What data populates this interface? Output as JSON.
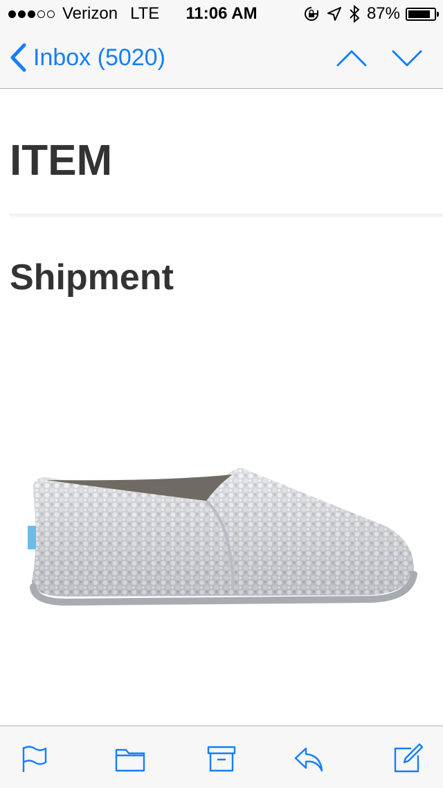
{
  "status_bar": {
    "carrier": "Verizon",
    "network": "LTE",
    "time": "11:06 AM",
    "battery_percent": "87%",
    "battery_level": 0.87,
    "signal_bars_filled": 3,
    "signal_bars_total": 5,
    "icons": [
      "rotation-lock-icon",
      "location-icon",
      "bluetooth-icon",
      "battery-icon"
    ]
  },
  "nav": {
    "back_label": "Inbox (5020)",
    "icons": [
      "chevron-left-icon",
      "chevron-up-icon",
      "chevron-down-icon"
    ]
  },
  "email": {
    "heading": "ITEM",
    "subheading": "Shipment",
    "image": "silver-glitter-slip-on-shoe"
  },
  "toolbar": {
    "icons": [
      "flag-icon",
      "folder-icon",
      "archive-icon",
      "reply-icon",
      "compose-icon"
    ]
  },
  "colors": {
    "accent": "#157efb",
    "heading_text": "#333333",
    "bar_background": "#f7f7f7"
  }
}
